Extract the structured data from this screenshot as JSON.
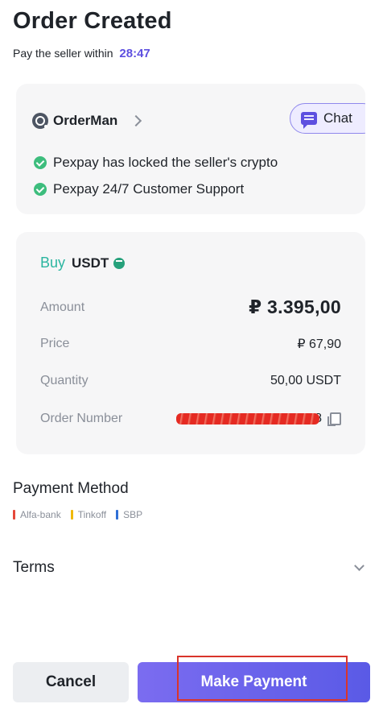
{
  "header": {
    "title": "Order Created",
    "subtitle_prefix": "Pay the seller within",
    "countdown": "28:47",
    "accent_color": "#5d4fe0"
  },
  "merchant_card": {
    "merchant_name": "OrderMan",
    "chat_label": "Chat",
    "assurances": [
      "Pexpay has locked the seller's crypto",
      "Pexpay 24/7 Customer Support"
    ]
  },
  "order_card": {
    "side": "Buy",
    "side_color": "#2bb5a0",
    "asset": "USDT",
    "rows": {
      "amount": {
        "label": "Amount",
        "value": "₽ 3.395,00"
      },
      "price": {
        "label": "Price",
        "value": "₽ 67,90"
      },
      "quantity": {
        "label": "Quantity",
        "value": "50,00 USDT"
      },
      "order_number": {
        "label": "Order Number",
        "value_suffix": "8"
      }
    }
  },
  "payment": {
    "title": "Payment Method",
    "methods": [
      {
        "name": "Alfa-bank",
        "color": "#e5483b"
      },
      {
        "name": "Tinkoff",
        "color": "#f0b90b"
      },
      {
        "name": "SBP",
        "color": "#2f6fd6"
      }
    ]
  },
  "terms": {
    "label": "Terms"
  },
  "footer": {
    "cancel_label": "Cancel",
    "pay_label": "Make Payment"
  },
  "icons": [
    "avatar",
    "chevron-right-icon",
    "chat-icon",
    "check-circle-icon",
    "tether-icon",
    "copy-icon",
    "chevron-down-icon"
  ]
}
